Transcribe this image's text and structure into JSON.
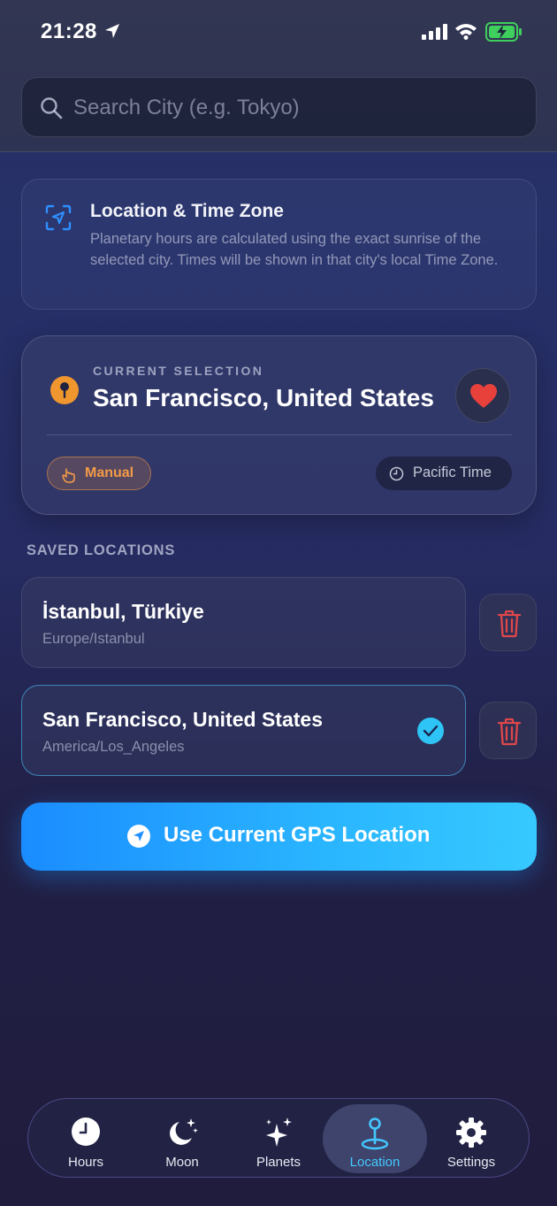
{
  "status_bar": {
    "time": "21:28"
  },
  "search": {
    "placeholder": "Search City (e.g. Tokyo)"
  },
  "info_card": {
    "title": "Location & Time Zone",
    "description": "Planetary hours are calculated using the exact sunrise of the selected city. Times will be shown in that city's local Time Zone."
  },
  "current_selection": {
    "label": "CURRENT SELECTION",
    "city": "San Francisco, United States",
    "mode_badge": "Manual",
    "timezone_badge": "Pacific Time"
  },
  "saved_locations": {
    "label": "SAVED LOCATIONS",
    "items": [
      {
        "city": "İstanbul, Türkiye",
        "timezone": "Europe/Istanbul",
        "selected": false
      },
      {
        "city": "San Francisco, United States",
        "timezone": "America/Los_Angeles",
        "selected": true
      }
    ]
  },
  "gps_button": {
    "label": "Use Current GPS Location"
  },
  "tab_bar": {
    "tabs": [
      {
        "label": "Hours",
        "icon": "clock-icon"
      },
      {
        "label": "Moon",
        "icon": "moon-stars-icon"
      },
      {
        "label": "Planets",
        "icon": "sparkles-icon"
      },
      {
        "label": "Location",
        "icon": "location-pin-icon",
        "active": true
      },
      {
        "label": "Settings",
        "icon": "gear-icon"
      }
    ]
  },
  "colors": {
    "accent_blue": "#2ab6ff",
    "active_tab": "#43c8ff",
    "manual_orange": "#f39a48",
    "heart_red": "#e8413c",
    "delete_red": "#e0474a"
  }
}
